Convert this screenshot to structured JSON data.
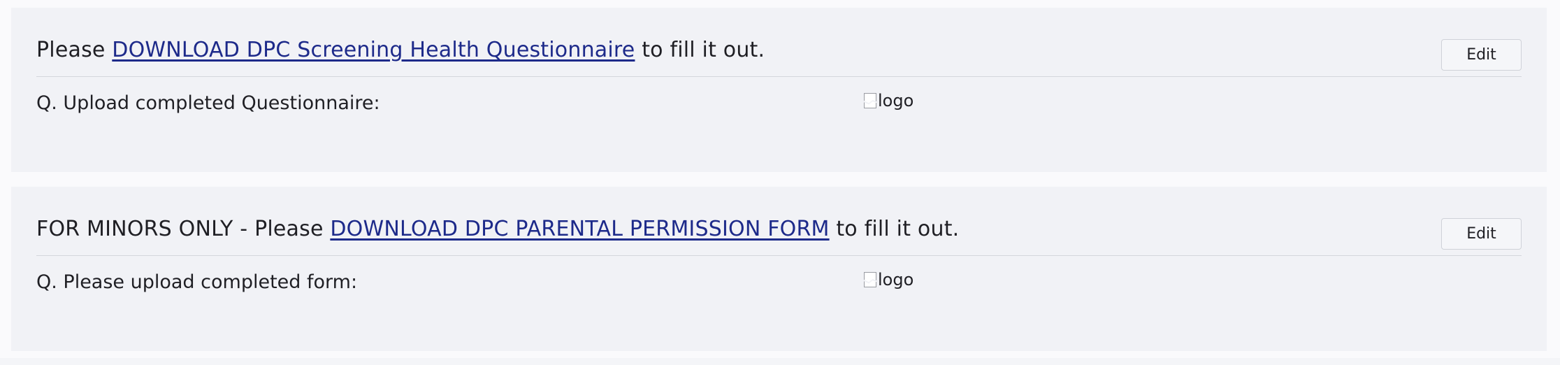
{
  "sections": [
    {
      "title_prefix": "Please ",
      "link_text": "DOWNLOAD DPC Screening Health Questionnaire",
      "title_suffix": " to fill it out.",
      "edit_label": "Edit",
      "question": "Q. Upload completed Questionnaire:",
      "answer_alt": "logo"
    },
    {
      "title_prefix": "FOR MINORS ONLY - Please ",
      "link_text": "DOWNLOAD DPC PARENTAL PERMISSION FORM",
      "title_suffix": " to fill it out.",
      "edit_label": "Edit",
      "question": "Q. Please upload completed form:",
      "answer_alt": "logo"
    }
  ],
  "colors": {
    "card_background": "#f1f2f6",
    "link": "#1d2a8a",
    "text": "#1f1f24"
  }
}
